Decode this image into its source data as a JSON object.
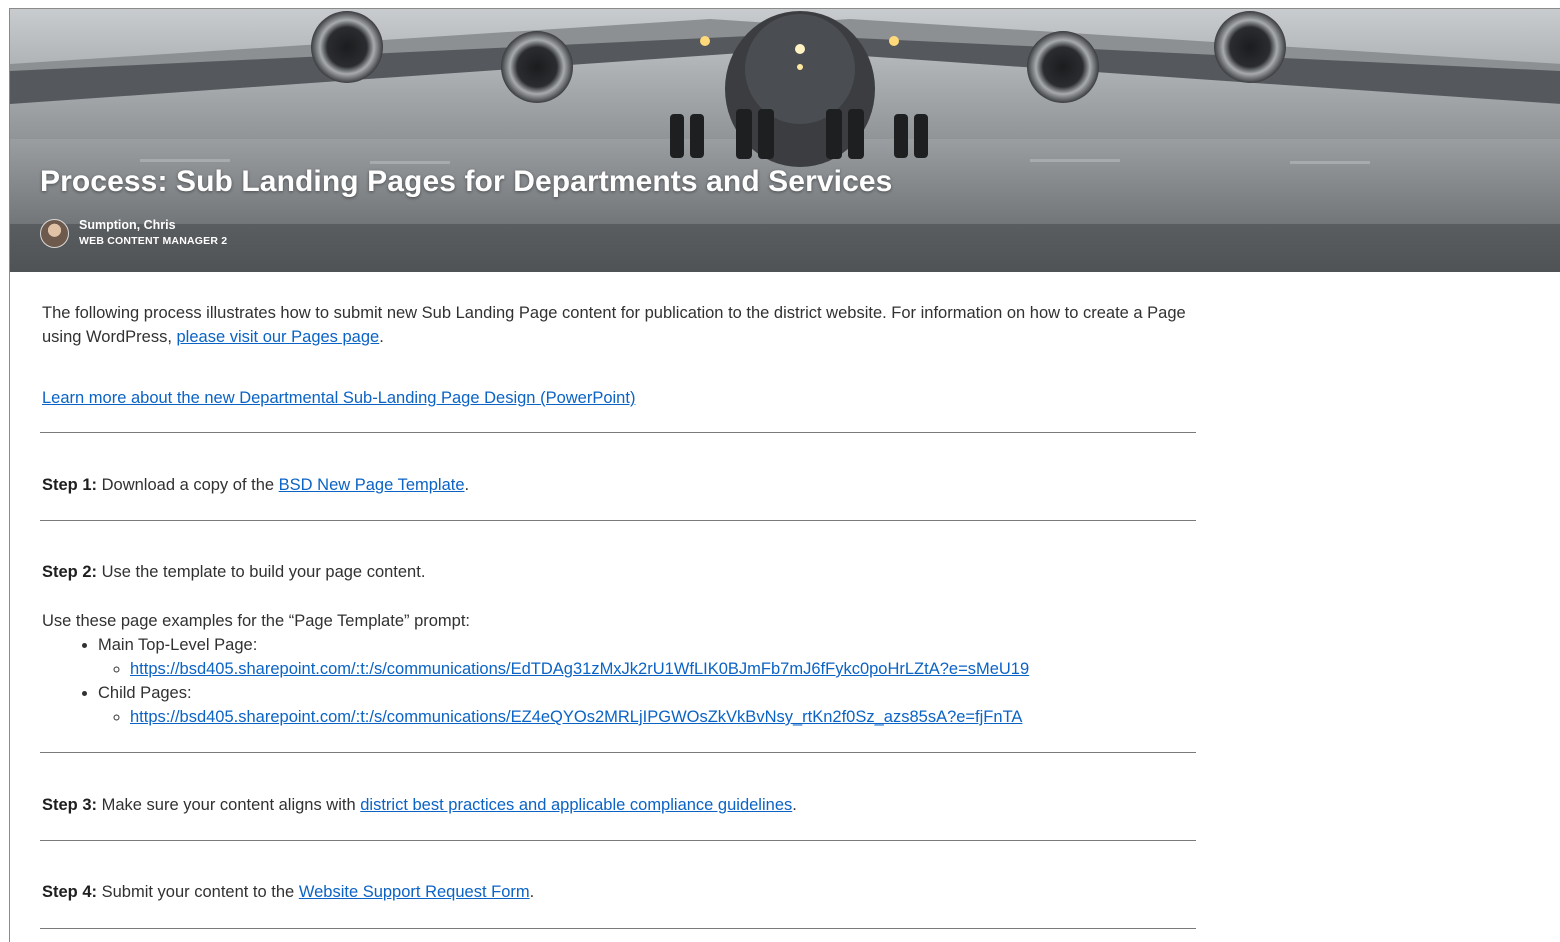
{
  "page": {
    "title": "Process: Sub Landing Pages for Departments and Services",
    "author_name": "Sumption, Chris",
    "author_role": "WEB CONTENT MANAGER 2"
  },
  "intro": {
    "text": "The following process illustrates how to submit new Sub Landing Page content for publication to the district website. For information on how to create a Page using WordPress, ",
    "link": "please visit our Pages page",
    "end": "."
  },
  "learn_more_link": "Learn more about the new Departmental Sub-Landing Page Design (PowerPoint)",
  "steps": [
    {
      "label": "Step 1:",
      "text": "Download a copy of the ",
      "link": "BSD New Page Template",
      "end": "."
    },
    {
      "label": "Step 2:",
      "text": "Use the template to build your page content.",
      "link": "",
      "end": ""
    },
    {
      "label": "Step 3:",
      "text": "Make sure your content aligns with ",
      "link": "district best practices and applicable compliance guidelines",
      "end": "."
    },
    {
      "label": "Step 4:",
      "text": "Submit your content to the ",
      "link": "Website Support Request Form",
      "end": "."
    }
  ],
  "examples": {
    "intro": "Use these page examples for the “Page Template” prompt:",
    "items": [
      {
        "label": "Main Top-Level Page:",
        "url": "https://bsd405.sharepoint.com/:t:/s/communications/EdTDAg31zMxJk2rU1WfLIK0BJmFb7mJ6fFykc0poHrLZtA?e=sMeU19"
      },
      {
        "label": "Child Pages:",
        "url": "https://bsd405.sharepoint.com/:t:/s/communications/EZ4eQYOs2MRLjIPGWOsZkVkBvNsy_rtKn2f0Sz_azs85sA?e=fjFnTA"
      }
    ]
  },
  "colors": {
    "link": "#0b63c5",
    "text": "#323130",
    "rule": "#7a7a7a"
  }
}
